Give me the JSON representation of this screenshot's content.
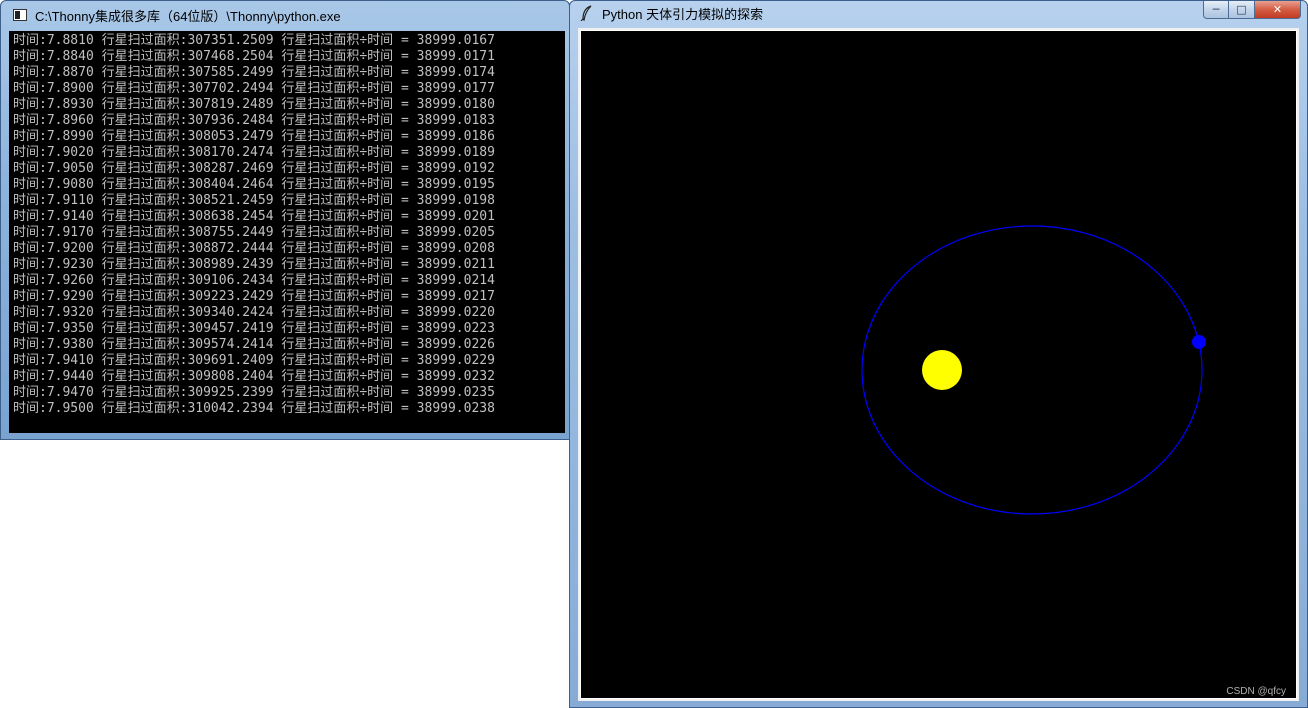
{
  "console_window": {
    "title": "C:\\Thonny集成很多库（64位版）\\Thonny\\python.exe",
    "lines": [
      "时间:7.8810 行星扫过面积:307351.2509 行星扫过面积÷时间 = 38999.0167",
      "时间:7.8840 行星扫过面积:307468.2504 行星扫过面积÷时间 = 38999.0171",
      "时间:7.8870 行星扫过面积:307585.2499 行星扫过面积÷时间 = 38999.0174",
      "时间:7.8900 行星扫过面积:307702.2494 行星扫过面积÷时间 = 38999.0177",
      "时间:7.8930 行星扫过面积:307819.2489 行星扫过面积÷时间 = 38999.0180",
      "时间:7.8960 行星扫过面积:307936.2484 行星扫过面积÷时间 = 38999.0183",
      "时间:7.8990 行星扫过面积:308053.2479 行星扫过面积÷时间 = 38999.0186",
      "时间:7.9020 行星扫过面积:308170.2474 行星扫过面积÷时间 = 38999.0189",
      "时间:7.9050 行星扫过面积:308287.2469 行星扫过面积÷时间 = 38999.0192",
      "时间:7.9080 行星扫过面积:308404.2464 行星扫过面积÷时间 = 38999.0195",
      "时间:7.9110 行星扫过面积:308521.2459 行星扫过面积÷时间 = 38999.0198",
      "时间:7.9140 行星扫过面积:308638.2454 行星扫过面积÷时间 = 38999.0201",
      "时间:7.9170 行星扫过面积:308755.2449 行星扫过面积÷时间 = 38999.0205",
      "时间:7.9200 行星扫过面积:308872.2444 行星扫过面积÷时间 = 38999.0208",
      "时间:7.9230 行星扫过面积:308989.2439 行星扫过面积÷时间 = 38999.0211",
      "时间:7.9260 行星扫过面积:309106.2434 行星扫过面积÷时间 = 38999.0214",
      "时间:7.9290 行星扫过面积:309223.2429 行星扫过面积÷时间 = 38999.0217",
      "时间:7.9320 行星扫过面积:309340.2424 行星扫过面积÷时间 = 38999.0220",
      "时间:7.9350 行星扫过面积:309457.2419 行星扫过面积÷时间 = 38999.0223",
      "时间:7.9380 行星扫过面积:309574.2414 行星扫过面积÷时间 = 38999.0226",
      "时间:7.9410 行星扫过面积:309691.2409 行星扫过面积÷时间 = 38999.0229",
      "时间:7.9440 行星扫过面积:309808.2404 行星扫过面积÷时间 = 38999.0232",
      "时间:7.9470 行星扫过面积:309925.2399 行星扫过面积÷时间 = 38999.0235",
      "时间:7.9500 行星扫过面积:310042.2394 行星扫过面积÷时间 = 38999.0238"
    ]
  },
  "sim_window": {
    "title": "Python 天体引力模拟的探索",
    "controls": {
      "minimize": "─",
      "maximize": "□",
      "close": "✕"
    },
    "colors": {
      "background": "#000000",
      "sun": "#ffff00",
      "planet": "#0000ff",
      "orbit": "#0000ff"
    },
    "icons": {
      "app": "feather-icon"
    }
  },
  "watermark": "CSDN @qfcy"
}
